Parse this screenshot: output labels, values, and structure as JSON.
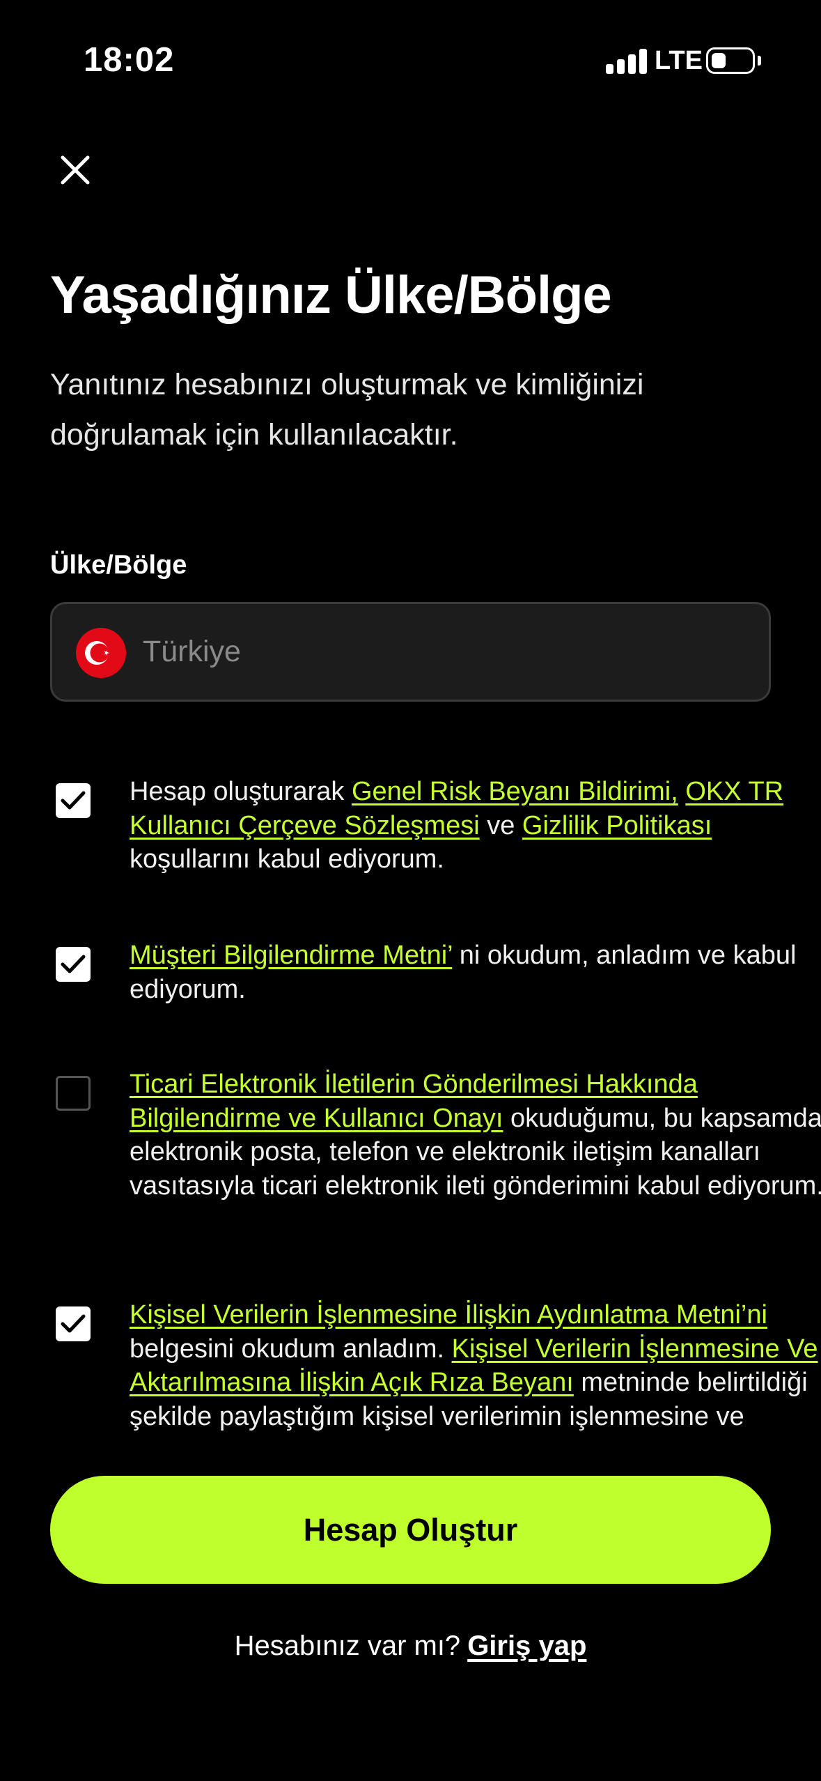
{
  "status_bar": {
    "time": "18:02",
    "network": "LTE"
  },
  "header": {
    "close_icon": "close-icon"
  },
  "title": "Yaşadığınız Ülke/Bölge",
  "subtitle": "Yanıtınız hesabınızı oluşturmak ve kimliğinizi doğrulamak için kullanılacaktır.",
  "country_field": {
    "label": "Ülke/Bölge",
    "value": "Türkiye",
    "flag_icon": "turkey-flag-icon"
  },
  "consents": [
    {
      "checked": true,
      "prefix": "Hesap oluşturarak ",
      "link1": "Genel Risk Beyanı Bildirimi,",
      "sep1": " ",
      "link2": "OKX TR Kullanıcı Çerçeve Sözleşmesi",
      "sep2": " ve ",
      "link3": "Gizlilik Politikası",
      "suffix": " koşullarını kabul ediyorum."
    },
    {
      "checked": true,
      "link1": "Müşteri Bilgilendirme Metni’",
      "suffix": " ni okudum, anladım ve kabul ediyorum."
    },
    {
      "checked": false,
      "link1": "Ticari Elektronik İletilerin Gönderilmesi Hakkında Bilgilendirme ve Kullanıcı Onayı",
      "suffix": " okuduğumu, bu kapsamda elektronik posta, telefon ve elektronik iletişim kanalları vasıtasıyla ticari elektronik ileti gönderimini kabul ediyorum."
    },
    {
      "checked": true,
      "link1": "Kişisel Verilerin İşlenmesine İlişkin Aydınlatma Metni’ni",
      "mid": " belgesini okudum anladım. ",
      "link2": "Kişisel Verilerin İşlenmesine Ve Aktarılmasına İlişkin Açık Rıza Beyanı",
      "suffix": " metninde belirtildiği şekilde paylaştığım kişisel verilerimin işlenmesine ve"
    }
  ],
  "primary_button": {
    "label": "Hesap Oluştur"
  },
  "login": {
    "prompt": "Hesabınız var mı?",
    "link": "Giriş yap"
  },
  "colors": {
    "accent": "#bfff2c",
    "link": "#c6ff30",
    "background": "#000000",
    "field_bg": "#1c1c1c",
    "flag_red": "#e30a17"
  }
}
